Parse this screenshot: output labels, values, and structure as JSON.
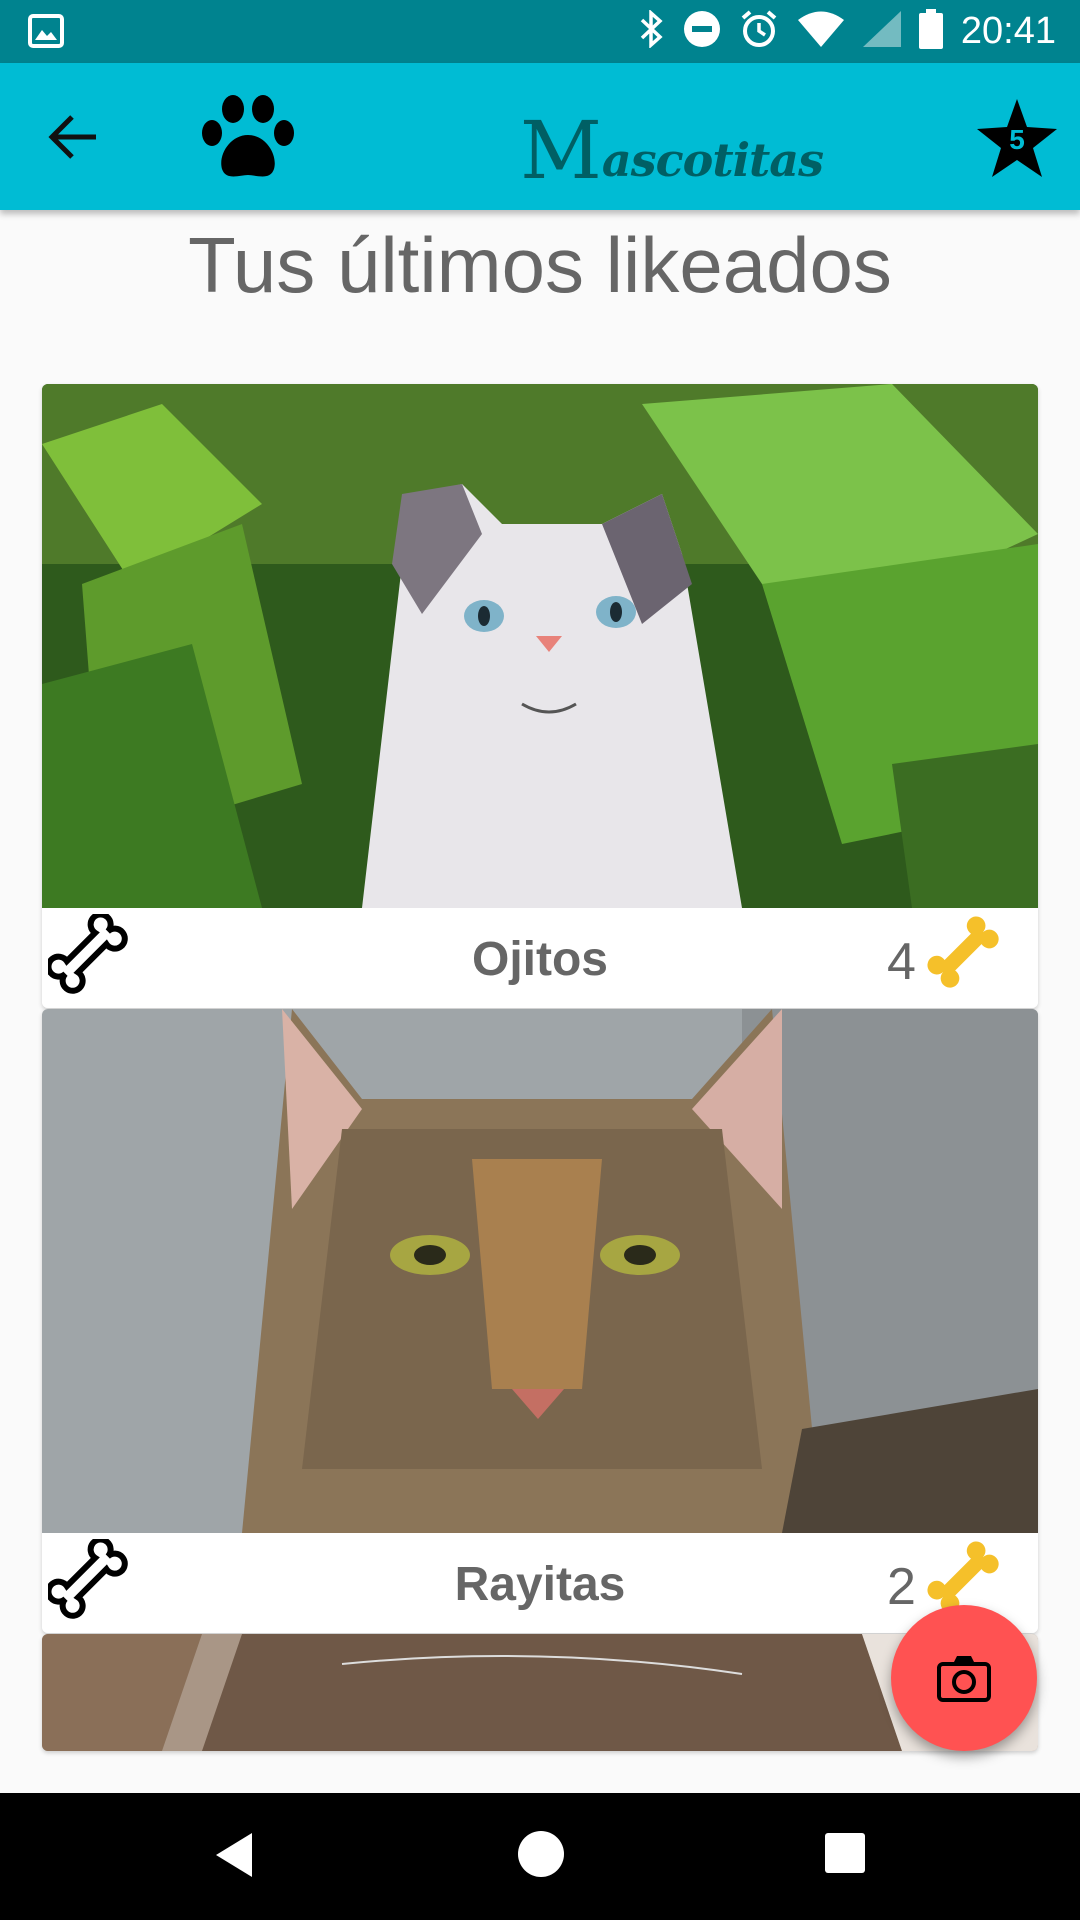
{
  "status_bar": {
    "time": "20:41",
    "icons": [
      "image-notification-icon",
      "bluetooth-icon",
      "do-not-disturb-icon",
      "alarm-icon",
      "wifi-icon",
      "signal-icon",
      "battery-icon"
    ]
  },
  "app_bar": {
    "title_initial": "M",
    "title_rest": "ascotitas",
    "favorites_count": "5",
    "colors": {
      "background": "#00bcd4",
      "status": "#00838f",
      "title": "#005f64"
    }
  },
  "page": {
    "title": "Tus últimos likeados"
  },
  "cards": [
    {
      "name": "Ojitos",
      "likes": "4"
    },
    {
      "name": "Rayitas",
      "likes": "2"
    },
    {
      "name": "",
      "likes": ""
    }
  ],
  "fab": {
    "icon": "camera-icon",
    "color": "#ff5252"
  }
}
